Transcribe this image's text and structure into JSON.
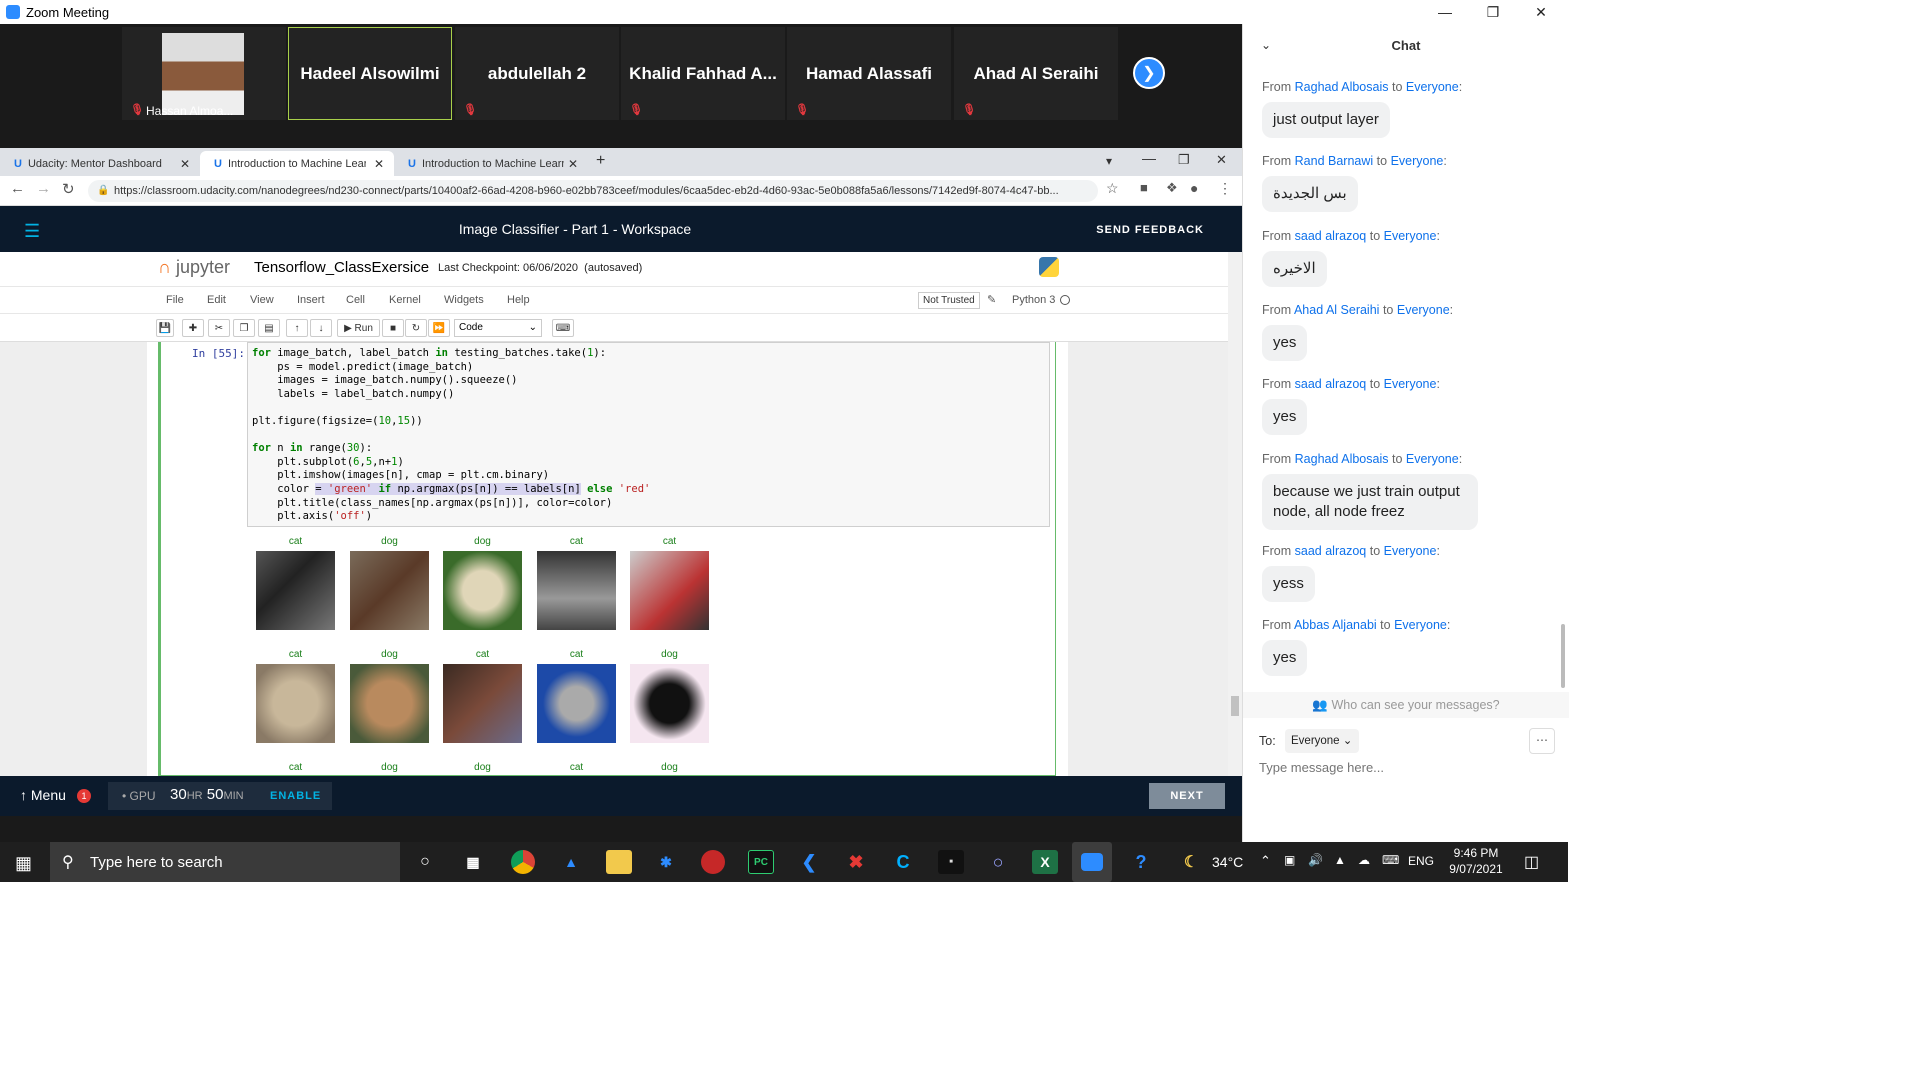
{
  "window": {
    "title": "Zoom Meeting"
  },
  "participants": [
    {
      "name": "Hassan Almoa..."
    },
    {
      "name": "Hadeel Alsowilmi"
    },
    {
      "name": "abdulellah 2"
    },
    {
      "name": "Khalid  Fahhad  A..."
    },
    {
      "name": "Hamad Alassafi"
    },
    {
      "name": "Ahad Al Seraihi"
    }
  ],
  "browser": {
    "tabs": [
      {
        "label": "Udacity: Mentor Dashboard"
      },
      {
        "label": "Introduction to Machine Learning"
      },
      {
        "label": "Introduction to Machine Learning"
      }
    ],
    "url": "https://classroom.udacity.com/nanodegrees/nd230-connect/parts/10400af2-66ad-4208-b960-e02bb783ceef/modules/6caa5dec-eb2d-4d60-93ac-5e0b088fa5a6/lessons/7142ed9f-8074-4c47-bb..."
  },
  "udacity": {
    "workspace_title": "Image Classifier - Part 1 - Workspace",
    "send_feedback": "SEND FEEDBACK",
    "menu_label": "Menu",
    "menu_badge": "1",
    "gpu_label": "GPU",
    "gpu_hours": "30",
    "gpu_hr_unit": "HR",
    "gpu_minutes": "50",
    "gpu_min_unit": "MIN",
    "enable_label": "ENABLE",
    "next_label": "NEXT"
  },
  "jupyter": {
    "logo_text": "jupyter",
    "notebook_name": "Tensorflow_ClassExersice",
    "checkpoint": "Last Checkpoint: 06/06/2020",
    "autosave": "(autosaved)",
    "menus": [
      "File",
      "Edit",
      "View",
      "Insert",
      "Cell",
      "Kernel",
      "Widgets",
      "Help"
    ],
    "trust": "Not Trusted",
    "kernel": "Python 3",
    "run_label": "Run",
    "cell_type": "Code",
    "prompt": "In [55]:"
  },
  "output_images": {
    "row1": [
      "cat",
      "dog",
      "dog",
      "cat",
      "cat"
    ],
    "row2": [
      "cat",
      "dog",
      "cat",
      "cat",
      "dog"
    ],
    "row3": [
      "cat",
      "dog",
      "dog",
      "cat",
      "dog"
    ]
  },
  "chat": {
    "title": "Chat",
    "messages": [
      {
        "from": "Raghad Albosais",
        "to": "Everyone",
        "text": "just output layer"
      },
      {
        "from": "Rand Barnawi",
        "to": "Everyone",
        "text": "بس الجديدة"
      },
      {
        "from": "saad alrazoq",
        "to": "Everyone",
        "text": "الاخيره"
      },
      {
        "from": "Ahad Al Seraihi",
        "to": "Everyone",
        "text": "yes"
      },
      {
        "from": "saad alrazoq",
        "to": "Everyone",
        "text": "yes"
      },
      {
        "from": "Raghad Albosais",
        "to": "Everyone",
        "text": "because we just train output node, all node freez"
      },
      {
        "from": "saad alrazoq",
        "to": "Everyone",
        "text": "yess"
      },
      {
        "from": "Abbas Aljanabi",
        "to": "Everyone",
        "text": "yes"
      }
    ],
    "from_word": "From",
    "to_word": "to",
    "who_can_see": "Who can see your messages?",
    "to_label": "To:",
    "to_value": "Everyone",
    "input_placeholder": "Type message here..."
  },
  "taskbar": {
    "search_placeholder": "Type here to search",
    "temperature": "34°C",
    "language": "ENG",
    "time": "9:46 PM",
    "date": "9/07/2021"
  }
}
